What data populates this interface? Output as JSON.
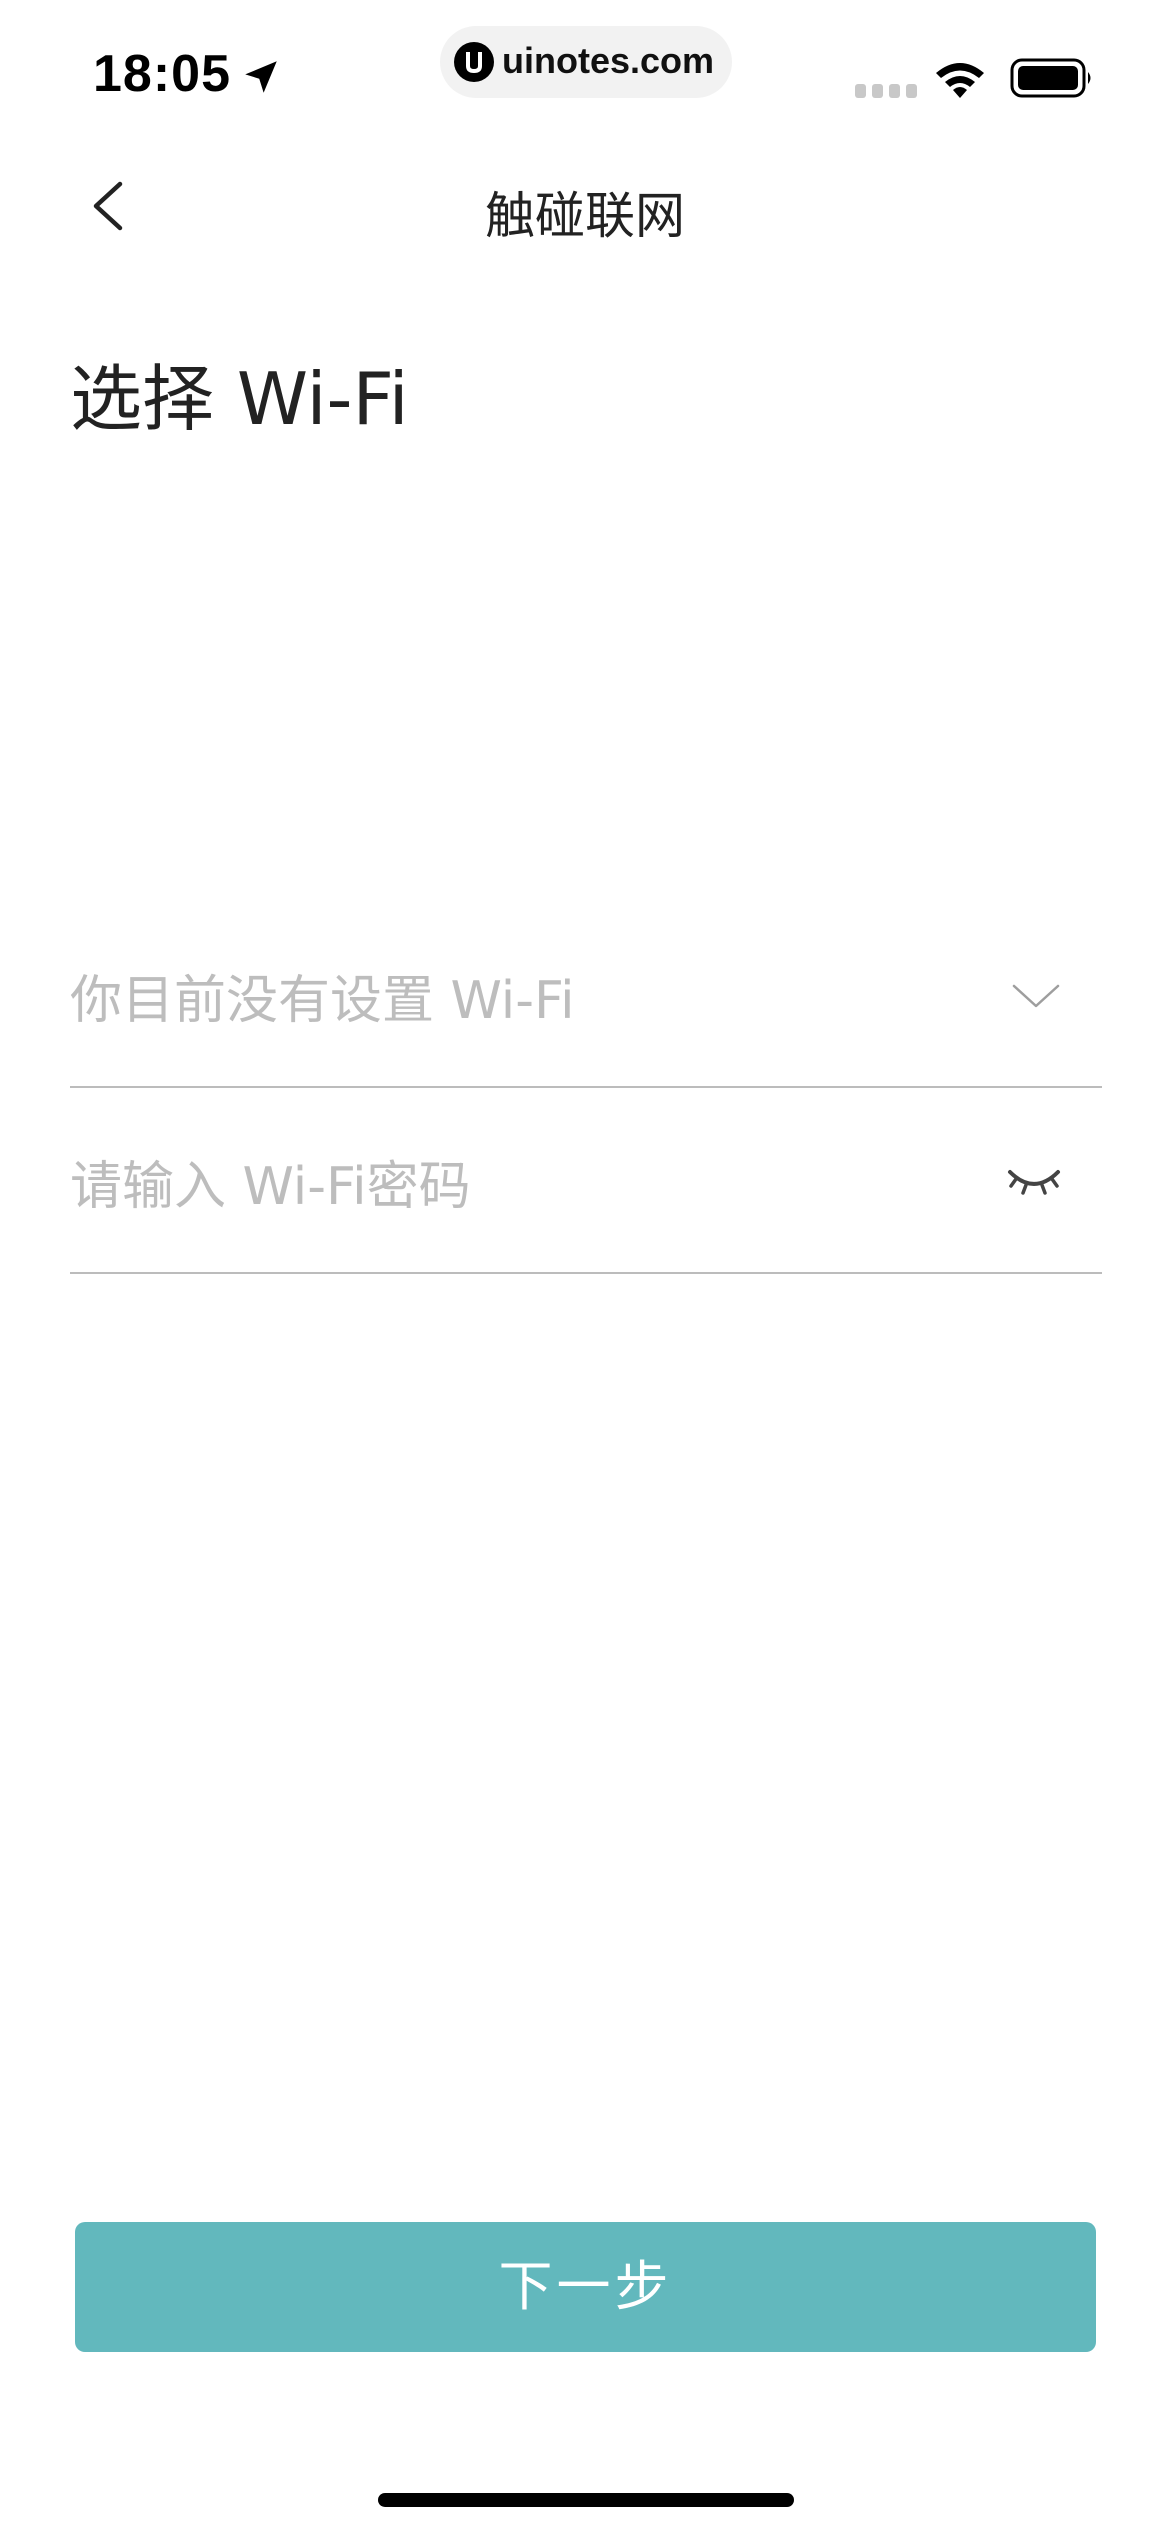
{
  "status_bar": {
    "time": "18:05",
    "url": "uinotes.com",
    "icons": [
      "location-arrow-icon",
      "uinotes-logo-icon",
      "cellular-signal-icon",
      "wifi-icon",
      "battery-icon"
    ]
  },
  "nav": {
    "back_icon": "chevron-left-icon",
    "title": "触碰联网"
  },
  "heading": "选择 Wi-Fi",
  "form": {
    "wifi_select": {
      "placeholder": "你目前没有设置 Wi-Fi",
      "icon": "chevron-down-icon"
    },
    "password": {
      "placeholder": "请输入 Wi-Fi密码",
      "icon": "eye-closed-icon"
    }
  },
  "next_button": {
    "label": "下一步"
  },
  "colors": {
    "accent": "#62b8bd",
    "placeholder": "#bdbdbd",
    "divider": "#bcbcbc",
    "text": "#222222"
  }
}
